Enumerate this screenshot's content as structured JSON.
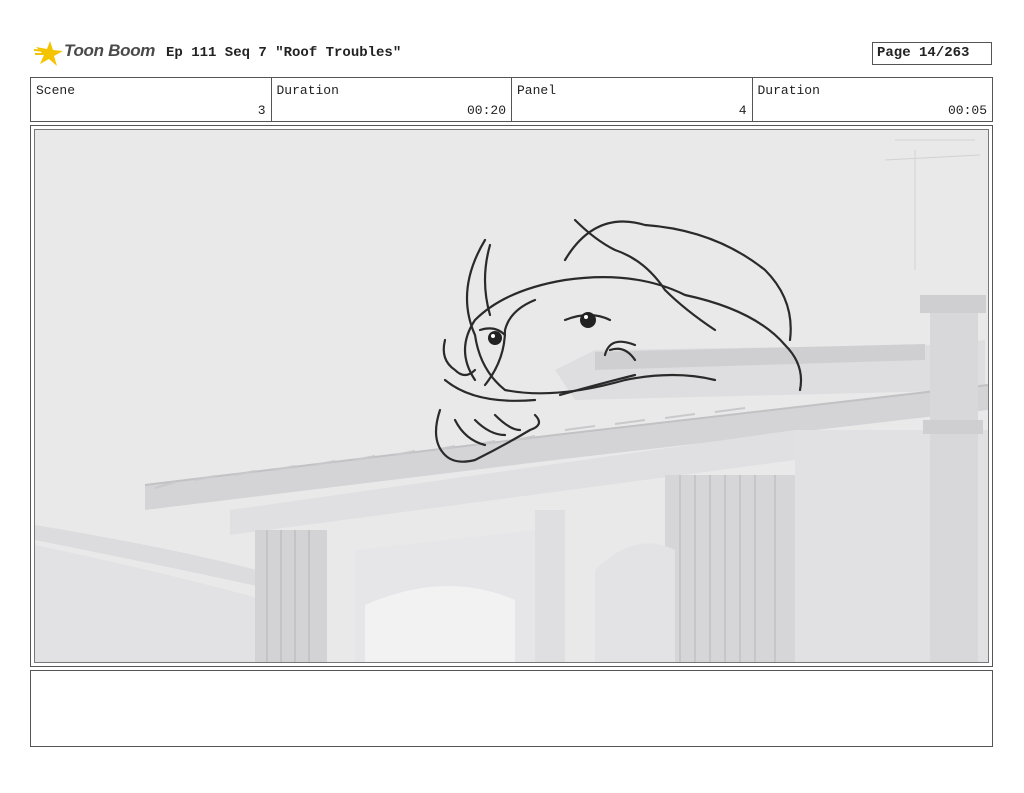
{
  "header": {
    "logo_text": "Toon Boom",
    "title": "Ep 111 Seq 7 \"Roof Troubles\"",
    "page": "Page  14/263"
  },
  "info": {
    "scene_label": "Scene",
    "scene_value": "3",
    "scene_duration_label": "Duration",
    "scene_duration_value": "00:20",
    "panel_label": "Panel",
    "panel_value": "4",
    "panel_duration_label": "Duration",
    "panel_duration_value": "00:05"
  },
  "panel": {
    "image_description": "character sketch peeking over roof edge",
    "background_color": "#e9e9ea"
  },
  "notes": {
    "text": ""
  }
}
